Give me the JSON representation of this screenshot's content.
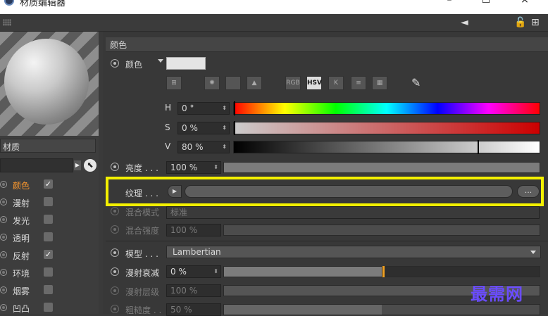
{
  "window": {
    "title": "材质编辑器",
    "minimize": "–",
    "maximize": "☐",
    "close": "×"
  },
  "toolbar": {
    "back_icon": "◄",
    "lock_icon": "🔓",
    "add_icon": "⊞"
  },
  "left": {
    "material_name": "材质",
    "channels": [
      {
        "label": "颜色",
        "checked": "✓"
      },
      {
        "label": "漫射",
        "checked": ""
      },
      {
        "label": "发光",
        "checked": ""
      },
      {
        "label": "透明",
        "checked": ""
      },
      {
        "label": "反射",
        "checked": "✓"
      },
      {
        "label": "环境",
        "checked": ""
      },
      {
        "label": "烟雾",
        "checked": ""
      },
      {
        "label": "凹凸",
        "checked": ""
      }
    ]
  },
  "color_section": {
    "header": "颜色",
    "color_label": "颜色",
    "modes": [
      "RGB",
      "HSV",
      "K"
    ],
    "h_label": "H",
    "h_value": "0 °",
    "s_label": "S",
    "s_value": "0 %",
    "v_label": "V",
    "v_value": "80 %",
    "brightness_label": "亮度 . . .",
    "brightness_value": "100 %",
    "texture_label": "纹理 . . .",
    "texture_more": "...",
    "blend_mode_label": "混合模式",
    "blend_mode_value": "标准",
    "blend_strength_label": "混合强度",
    "blend_strength_value": "100 %"
  },
  "diffuse_section": {
    "model_label": "模型 . . .",
    "model_value": "Lambertian",
    "diffuse_falloff_label": "漫射衰减",
    "diffuse_falloff_value": "0 %",
    "diffuse_level_label": "漫射层级",
    "diffuse_level_value": "100 %",
    "roughness_label": "粗糙度 . .",
    "roughness_value": "50 %"
  },
  "controls": {
    "brightness": 1.0,
    "hue_marker": 0.0,
    "sat_marker": 0.0,
    "val_marker": 0.8,
    "diffuse_falloff": 0.5,
    "diffuse_level": 1.0,
    "roughness": 0.5
  },
  "watermark": "最需网",
  "colors": {
    "accent": "#ff9a2e",
    "highlight": "#f3f000"
  }
}
